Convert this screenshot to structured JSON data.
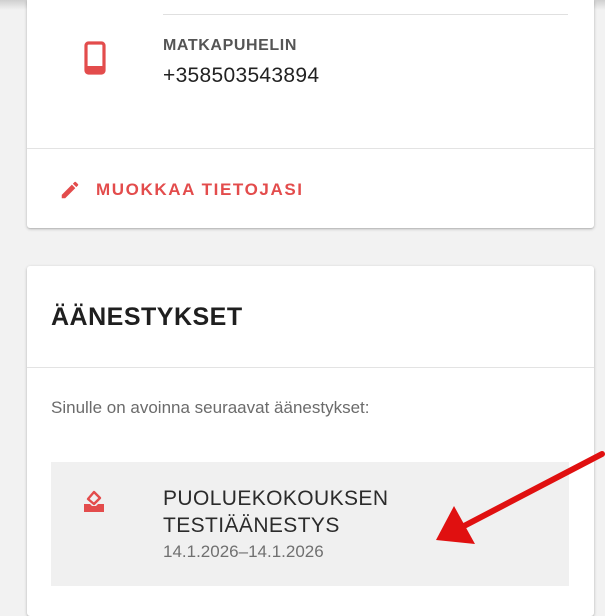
{
  "contact": {
    "phone_label": "MATKAPUHELIN",
    "phone_value": "+358503543894",
    "edit_label": "MUOKKAA TIETOJASI",
    "phone_icon": "mobile-phone-icon",
    "edit_icon": "pencil-icon"
  },
  "votes": {
    "title": "ÄÄNESTYKSET",
    "intro": "Sinulle on avoinna seuraavat äänestykset:",
    "items": [
      {
        "title": "PUOLUEKOKOUKSEN\nTESTIÄÄNESTYS",
        "dates": "14.1.2026–14.1.2026",
        "icon": "ballot-box-icon"
      }
    ]
  },
  "colors": {
    "accent": "#e34c4c",
    "annotation_arrow": "#e01010",
    "page_background": "#f2f2f2",
    "card_background": "#ffffff",
    "vote_item_background": "#f0f0f0"
  }
}
